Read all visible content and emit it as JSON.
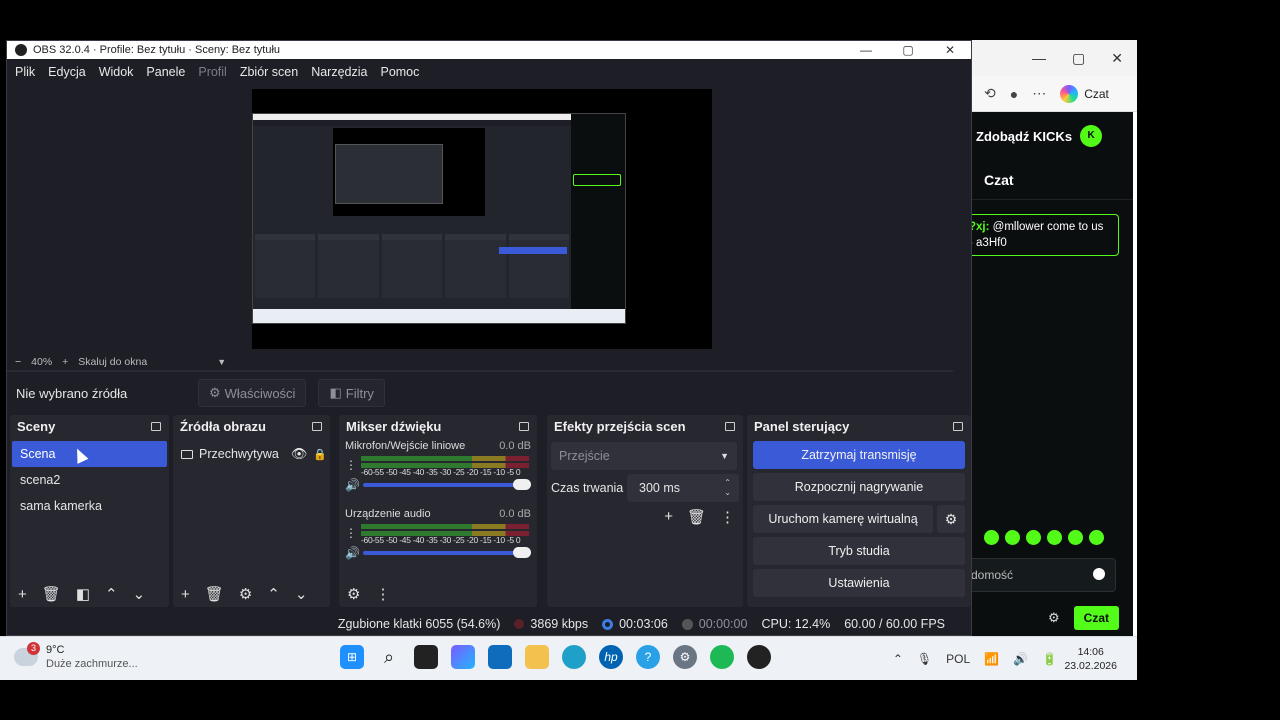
{
  "browser": {
    "window_controls": [
      "—",
      "▢",
      "✕"
    ],
    "copilot_label": "Czat",
    "kick": {
      "kicks_label": "Zdobądź KICKs",
      "chat_title": "Czat",
      "message_user": "?xj:",
      "message_text": "@mllower come to us - a3Hf0",
      "input_placeholder": "domość",
      "send_label": "Czat",
      "accent": "#53fc18"
    }
  },
  "obs": {
    "title": "OBS 32.0.4 · Profile: Bez tytułu · Sceny: Bez tytułu",
    "menu": {
      "items": [
        "Plik",
        "Edycja",
        "Widok",
        "Panele",
        "Profil",
        "Zbiór scen",
        "Narzędzia",
        "Pomoc"
      ]
    },
    "zoom": {
      "minus": "−",
      "value": "40%",
      "plus": "+",
      "scale_mode": "Skaluj do okna"
    },
    "context": {
      "no_source": "Nie wybrano źródła",
      "properties": "Właściwości",
      "filters": "Filtry"
    },
    "scenes": {
      "title": "Sceny",
      "items": [
        "Scena",
        "scena2",
        "sama kamerka"
      ]
    },
    "sources": {
      "title": "Źródła obrazu",
      "items": [
        "Przechwytywa"
      ]
    },
    "mixer": {
      "title": "Mikser dźwięku",
      "channels": [
        {
          "name": "Mikrofon/Wejście liniowe",
          "db": "0.0 dB"
        },
        {
          "name": "Urządzenie audio",
          "db": "0.0 dB"
        }
      ],
      "ticks": "-60-55 -50 -45 -40 -35 -30 -25 -20 -15 -10 -5  0"
    },
    "transitions": {
      "title": "Efekty przejścia scen",
      "combo_placeholder": "Przejście",
      "duration_label": "Czas trwania",
      "duration_value": "300 ms"
    },
    "controls": {
      "title": "Panel sterujący",
      "stop_stream": "Zatrzymaj transmisję",
      "start_recording": "Rozpocznij nagrywanie",
      "virtual_camera": "Uruchom kamerę wirtualną",
      "studio_mode": "Tryb studia",
      "settings": "Ustawienia"
    },
    "status": {
      "dropped": "Zgubione klatki 6055 (54.6%)",
      "bitrate": "3869 kbps",
      "stream_time": "00:03:06",
      "rec_time": "00:00:00",
      "cpu": "CPU: 12.4%",
      "fps": "60.00 / 60.00 FPS"
    },
    "accent": "#3b5ad8"
  },
  "taskbar": {
    "weather": {
      "badge": "3",
      "temp": "9°C",
      "desc": "Duże zachmurze..."
    },
    "language": "POL",
    "time": "14:06",
    "date": "23.02.2026"
  }
}
